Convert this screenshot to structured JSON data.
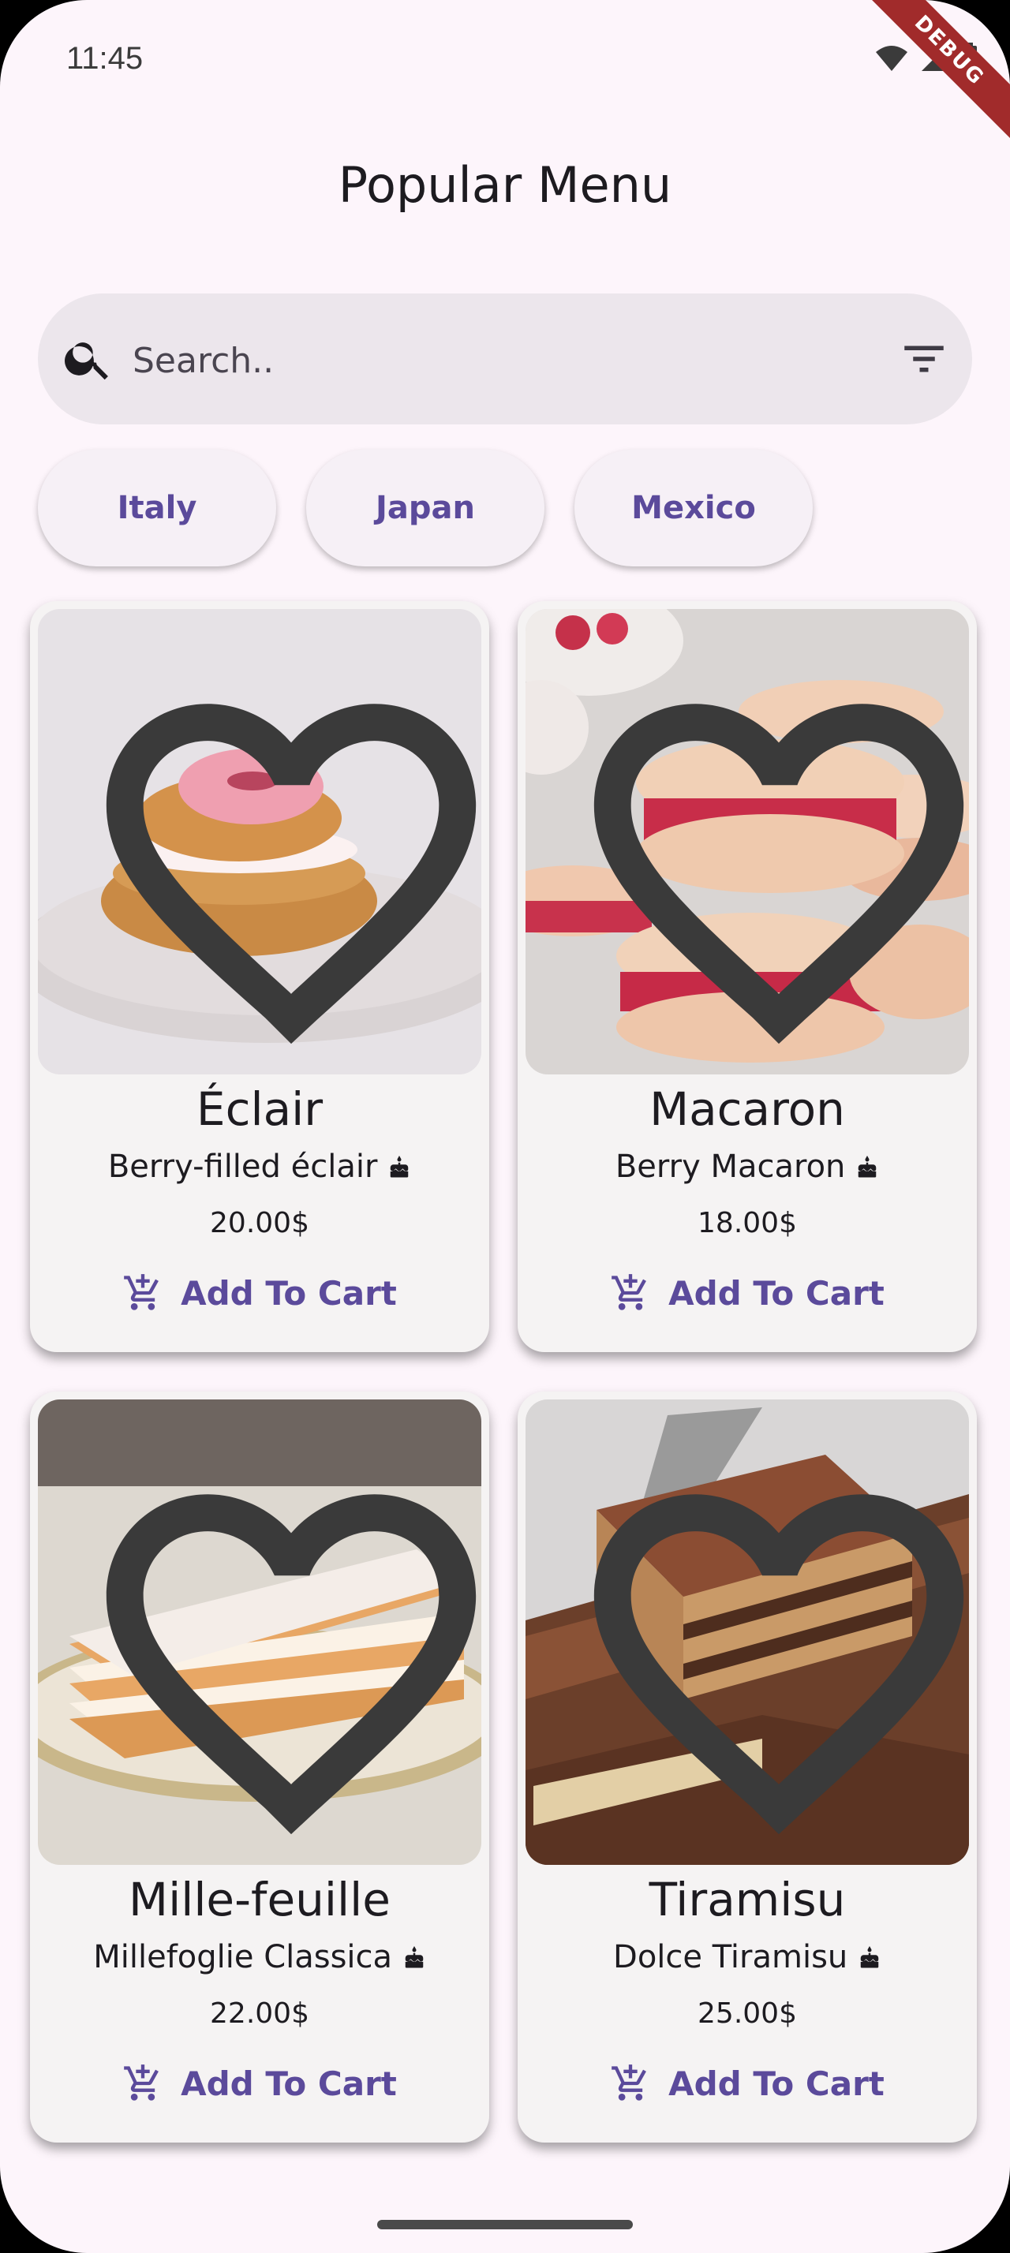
{
  "status": {
    "time": "11:45",
    "ribbon": "DEBUG"
  },
  "header": {
    "title": "Popular Menu"
  },
  "search": {
    "placeholder": "Search.."
  },
  "chips": [
    {
      "label": "Italy"
    },
    {
      "label": "Japan"
    },
    {
      "label": "Mexico"
    }
  ],
  "products": [
    {
      "name": "Éclair",
      "description": "Berry-filled éclair",
      "price": "20.00$",
      "cart_label": "Add To Cart",
      "image": "pink-cream-puff-on-plate"
    },
    {
      "name": "Macaron",
      "description": "Berry Macaron",
      "price": "18.00$",
      "cart_label": "Add To Cart",
      "image": "stacked-raspberry-macarons"
    },
    {
      "name": "Mille-feuille",
      "description": "Millefoglie Classica",
      "price": "22.00$",
      "cart_label": "Add To Cart",
      "image": "layered-pastry-on-plate"
    },
    {
      "name": "Tiramisu",
      "description": "Dolce Tiramisu",
      "price": "25.00$",
      "cart_label": "Add To Cart",
      "image": "tiramisu-slice-on-server"
    }
  ],
  "icons": {
    "search": "search-icon",
    "filter": "filter-icon",
    "favorite": "heart-outline-icon",
    "cart": "add-shopping-cart-icon",
    "cake": "cake-icon"
  },
  "colors": {
    "accent": "#5b4a9b",
    "background": "#fdf5fb",
    "card": "#f5f3f3",
    "search": "#ece6ec"
  }
}
